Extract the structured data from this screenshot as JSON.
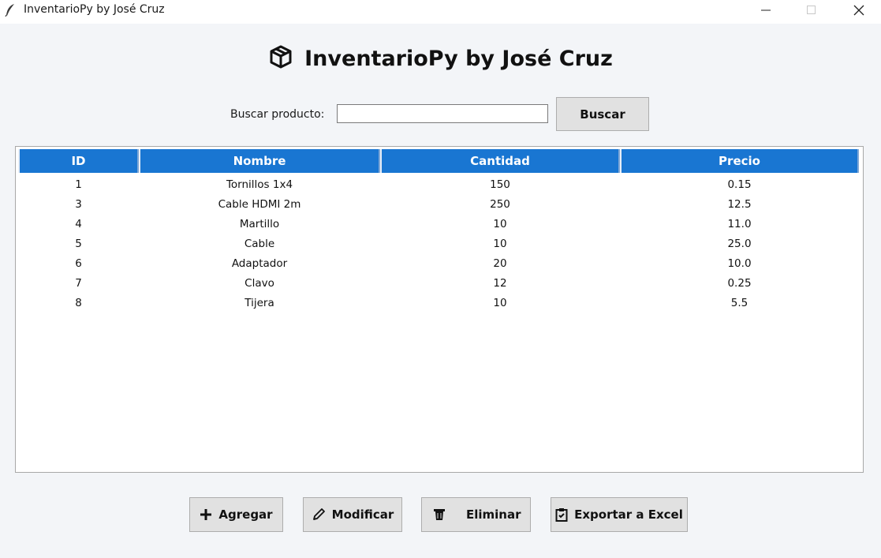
{
  "window": {
    "title": "InventarioPy by José Cruz",
    "icons": {
      "app": "feather-icon",
      "minimize": "minimize-icon",
      "maximize": "maximize-icon",
      "close": "close-icon"
    }
  },
  "header": {
    "title": "InventarioPy by José Cruz",
    "icon": "package-icon"
  },
  "search": {
    "label": "Buscar producto:",
    "value": "",
    "placeholder": "",
    "button_label": "Buscar"
  },
  "table": {
    "columns": [
      "ID",
      "Nombre",
      "Cantidad",
      "Precio"
    ],
    "header_color": "#1976d2",
    "rows": [
      [
        "1",
        "Tornillos 1x4",
        "150",
        "0.15"
      ],
      [
        "3",
        "Cable HDMI 2m",
        "250",
        "12.5"
      ],
      [
        "4",
        "Martillo",
        "10",
        "11.0"
      ],
      [
        "5",
        "Cable",
        "10",
        "25.0"
      ],
      [
        "6",
        "Adaptador",
        "20",
        "10.0"
      ],
      [
        "7",
        "Clavo",
        "12",
        "0.25"
      ],
      [
        "8",
        "Tijera",
        "10",
        "5.5"
      ]
    ]
  },
  "actions": {
    "add": {
      "label": "Agregar",
      "icon": "plus-icon"
    },
    "edit": {
      "label": "Modificar",
      "icon": "pencil-icon"
    },
    "delete": {
      "label": "Eliminar",
      "icon": "trash-icon"
    },
    "export": {
      "label": "Exportar a Excel",
      "icon": "clipboard-icon"
    }
  }
}
